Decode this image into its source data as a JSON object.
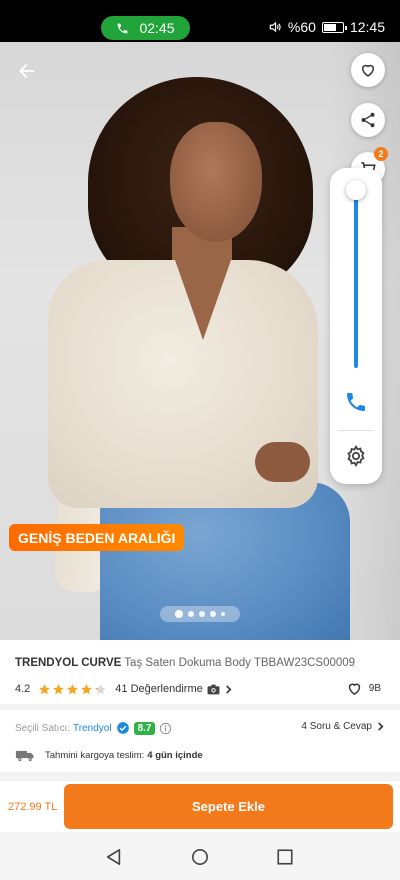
{
  "status_bar": {
    "call_timer": "02:45",
    "battery": "%60",
    "time": "12:45"
  },
  "product_image": {
    "badge": "GENİŞ BEDEN ARALIĞI",
    "dot_count": 5,
    "active_dot": 0
  },
  "cart": {
    "count": "2"
  },
  "volume": {
    "level": 1.0
  },
  "product": {
    "brand": "TRENDYOL CURVE",
    "name": "Taş Saten Dokuma Body TBBAW23CS00009",
    "rating": "4.2",
    "rating_value": 4.2,
    "reviews": "41 Değerlendirme",
    "favorites": "9B"
  },
  "seller": {
    "label": "Seçili Satıcı:",
    "name": "Trendyol",
    "score": "8.7",
    "qa": "4 Soru & Cevap"
  },
  "shipping": {
    "label": "Tahmini kargoya teslim:",
    "value": "4 gün içinde"
  },
  "action_bar": {
    "price": "272.99 TL",
    "add_to_cart": "Sepete Ekle"
  },
  "colors": {
    "accent": "#f27a1a",
    "call_green": "#21a53a",
    "star": "#f5a623",
    "link_blue": "#1e88e5",
    "score_green": "#2fb344"
  },
  "icons": [
    "phone-icon",
    "speaker-icon",
    "battery-icon",
    "back-arrow-icon",
    "heart-icon",
    "share-icon",
    "cart-icon",
    "gear-icon",
    "star-icon",
    "camera-icon",
    "chevron-right-icon",
    "verified-icon",
    "info-icon",
    "truck-icon",
    "back-triangle-icon",
    "home-circle-icon",
    "recents-square-icon"
  ]
}
